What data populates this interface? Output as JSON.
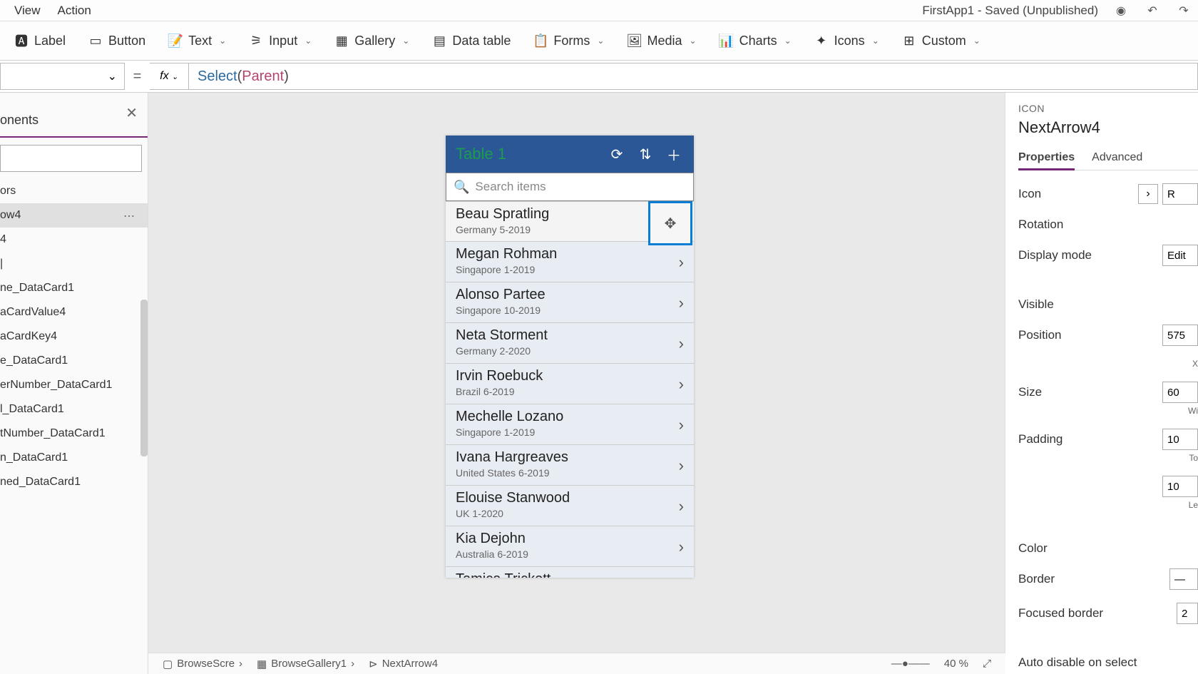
{
  "topMenu": {
    "view": "View",
    "action": "Action",
    "appTitle": "FirstApp1 - Saved (Unpublished)"
  },
  "ribbon": {
    "label": "Label",
    "button": "Button",
    "text": "Text",
    "input": "Input",
    "gallery": "Gallery",
    "datatable": "Data table",
    "forms": "Forms",
    "media": "Media",
    "charts": "Charts",
    "icons": "Icons",
    "custom": "Custom"
  },
  "formula": {
    "fn": "Select",
    "arg": "Parent"
  },
  "tree": {
    "tab": "onents",
    "items": [
      "ors",
      "ow4",
      "4",
      "|",
      "ne_DataCard1",
      "aCardValue4",
      "aCardKey4",
      "e_DataCard1",
      "erNumber_DataCard1",
      "l_DataCard1",
      "tNumber_DataCard1",
      "n_DataCard1",
      "ned_DataCard1"
    ],
    "selectedIndex": 1
  },
  "phone": {
    "title": "Table 1",
    "searchPlaceholder": "Search items",
    "rows": [
      {
        "name": "Beau Spratling",
        "sub": "Germany 5-2019"
      },
      {
        "name": "Megan Rohman",
        "sub": "Singapore 1-2019"
      },
      {
        "name": "Alonso Partee",
        "sub": "Singapore 10-2019"
      },
      {
        "name": "Neta Storment",
        "sub": "Germany 2-2020"
      },
      {
        "name": "Irvin Roebuck",
        "sub": "Brazil 6-2019"
      },
      {
        "name": "Mechelle Lozano",
        "sub": "Singapore 1-2019"
      },
      {
        "name": "Ivana Hargreaves",
        "sub": "United States 6-2019"
      },
      {
        "name": "Elouise Stanwood",
        "sub": "UK 1-2020"
      },
      {
        "name": "Kia Dejohn",
        "sub": "Australia 6-2019"
      },
      {
        "name": "Tamica Trickett",
        "sub": ""
      }
    ]
  },
  "props": {
    "category": "ICON",
    "name": "NextArrow4",
    "tabProperties": "Properties",
    "tabAdvanced": "Advanced",
    "rows": {
      "icon": "Icon",
      "iconVal": "R",
      "rotation": "Rotation",
      "displayMode": "Display mode",
      "displayModeVal": "Edit",
      "visible": "Visible",
      "position": "Position",
      "positionVal": "575",
      "size": "Size",
      "sizeVal": "60",
      "sizeLbl": "Wi",
      "padding": "Padding",
      "paddingVal1": "10",
      "paddingLbl1": "To",
      "paddingVal2": "10",
      "paddingLbl2": "Le",
      "color": "Color",
      "border": "Border",
      "focusedBorder": "Focused border",
      "focusedBorderVal": "2",
      "autoDisable": "Auto disable on select"
    }
  },
  "status": {
    "s1": "BrowseScre",
    "s2": "BrowseGallery1",
    "s3": "NextArrow4",
    "zoom": "40 %"
  }
}
